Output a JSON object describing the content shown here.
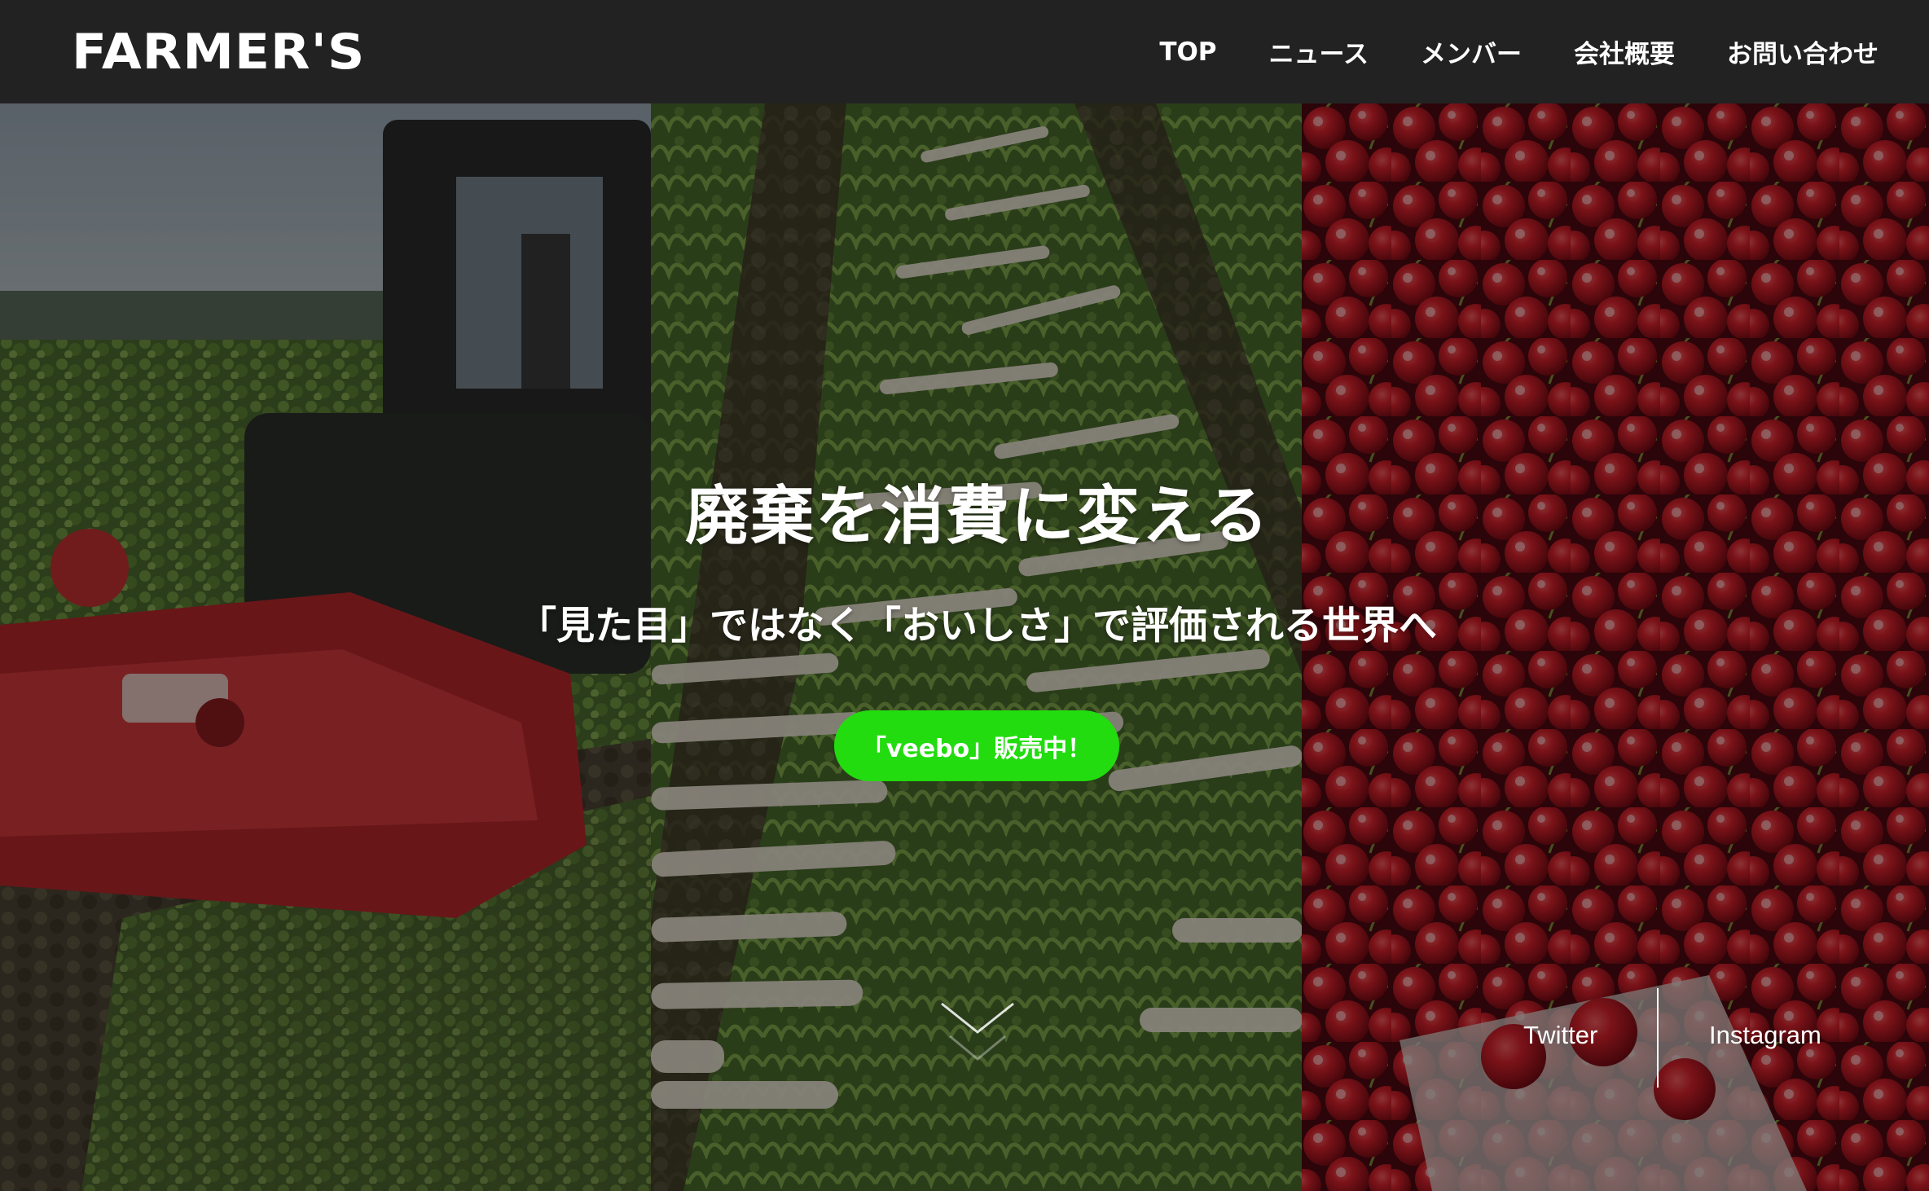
{
  "header": {
    "logo": "FARMER'S",
    "nav": [
      "TOP",
      "ニュース",
      "メンバー",
      "会社概要",
      "お問い合わせ"
    ]
  },
  "hero": {
    "headline": "廃棄を消費に変える",
    "subline": "「見た目」ではなく「おいしさ」で評価される世界へ",
    "cta_label": "「veebo」販売中！",
    "cta_color": "#22dc0f",
    "scroll_icon": "chevron-down-icon"
  },
  "social": {
    "twitter": "Twitter",
    "instagram": "Instagram"
  }
}
